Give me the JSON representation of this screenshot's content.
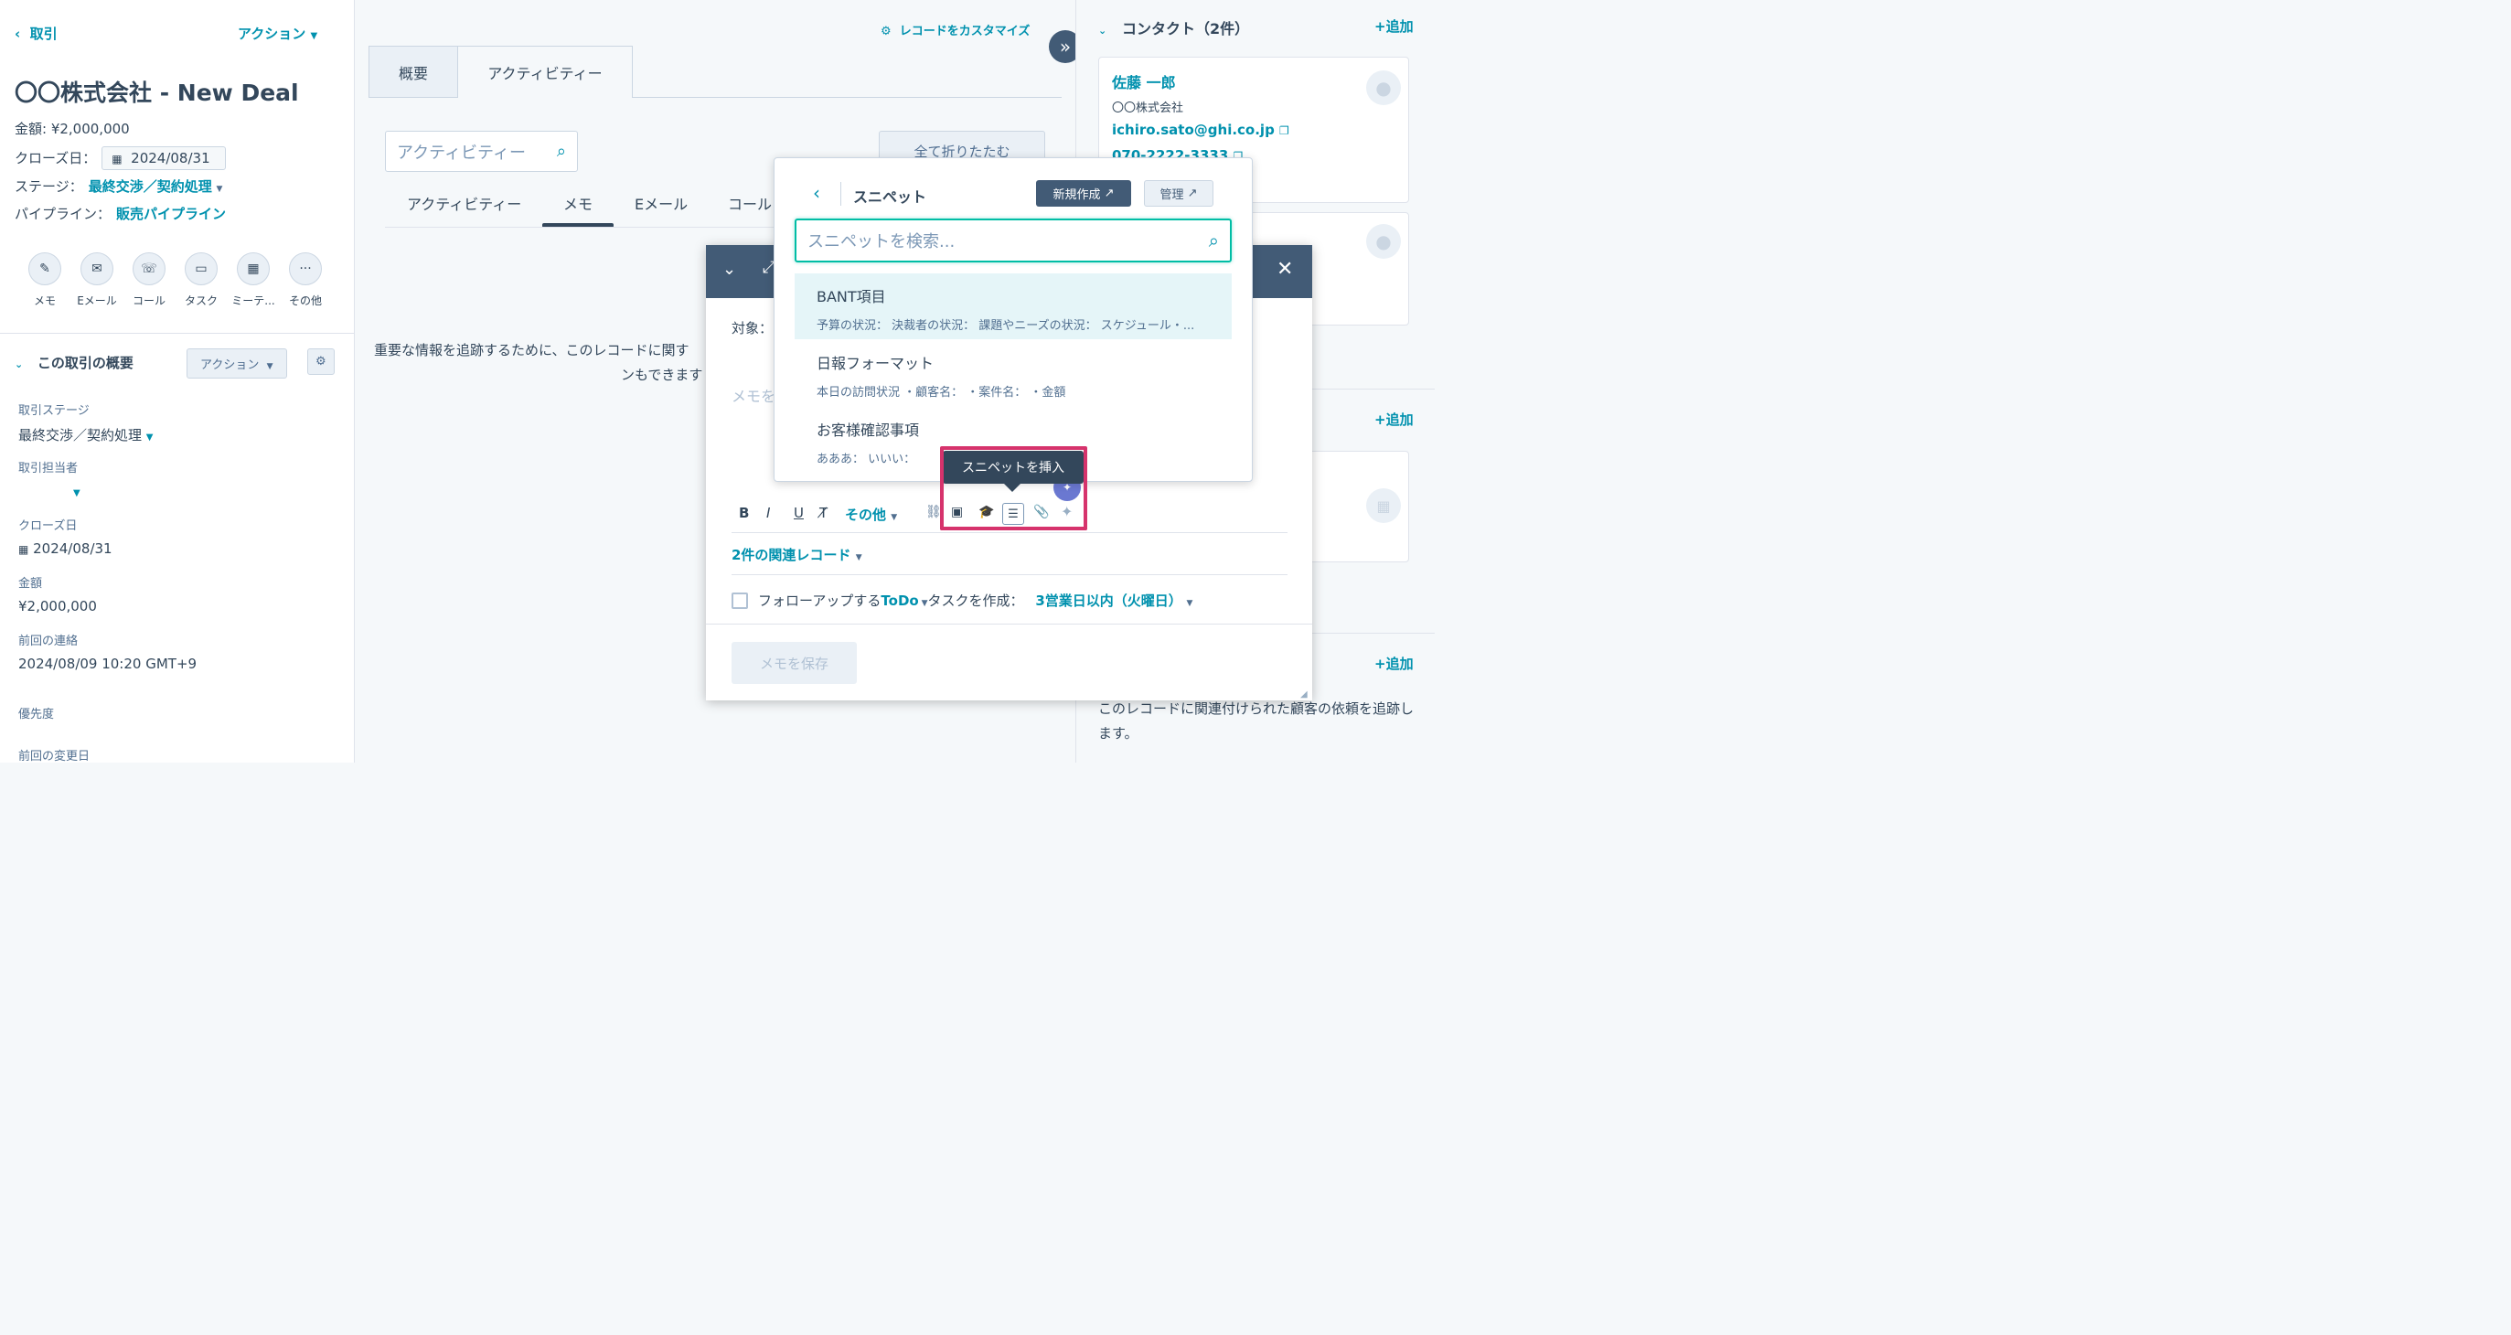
{
  "left": {
    "back_label": "取引",
    "actions_label": "アクション",
    "record_title": "〇〇株式会社 - New Deal",
    "amount_line": "金額: ¥2,000,000",
    "close_date_label": "クローズ日：",
    "close_date_value": "2024/08/31",
    "stage_label": "ステージ：",
    "stage_value": "最終交渉／契約処理",
    "pipeline_label": "パイプライン：",
    "pipeline_value": "販売パイプライン",
    "quick_actions": [
      "メモ",
      "Eメール",
      "コール",
      "タスク",
      "ミーテ...",
      "その他"
    ],
    "summary_title": "この取引の概要",
    "summary_actions": "アクション",
    "props": [
      {
        "label": "取引ステージ",
        "value": "最終交渉／契約処理"
      },
      {
        "label": "取引担当者",
        "value": ""
      },
      {
        "label": "クローズ日",
        "value": "2024/08/31"
      },
      {
        "label": "金額",
        "value": "¥2,000,000"
      },
      {
        "label": "前回の連絡",
        "value": "2024/08/09 10:20 GMT+9"
      },
      {
        "label": "優先度",
        "value": ""
      },
      {
        "label": "前回の変更日",
        "value": ""
      }
    ]
  },
  "middle": {
    "customize": "レコードをカスタマイズ",
    "tabs": [
      "概要",
      "アクティビティー"
    ],
    "search_placeholder": "アクティビティー",
    "collapse_all": "全て折りたたむ",
    "subtabs": [
      "アクティビティー",
      "メモ",
      "Eメール",
      "コール"
    ],
    "empty_text_1": "重要な情報を追跡するために、このレコードに関す",
    "empty_text_2": "ンもできます"
  },
  "right": {
    "contacts_title": "コンタクト（2件）",
    "add": "+追加",
    "contact_name": "佐藤 一郎",
    "contact_company": "〇〇株式会社",
    "contact_email": "ichiro.sato@ghi.co.jp",
    "contact_phone": "070-2222-3333",
    "ticket_text": "このレコードに関連付けられた顧客の依頼を追跡します。"
  },
  "modal": {
    "target_label": "対象：",
    "note_placeholder": "メモを",
    "more_label": "その他",
    "tooltip": "スニペットを挿入",
    "assoc_label": "2件の関連レコード",
    "followup_a": "フォローアップする",
    "followup_todo": "ToDo",
    "followup_b": "タスクを作成：",
    "followup_due": "3営業日以内（火曜日）",
    "save_label": "メモを保存"
  },
  "snippets": {
    "title": "スニペット",
    "new_label": "新規作成",
    "manage_label": "管理",
    "search_placeholder": "スニペットを検索...",
    "items": [
      {
        "title": "BANT項目",
        "desc": "予算の状況： 決裁者の状況： 課題やニーズの状況： スケジュール・..."
      },
      {
        "title": "日報フォーマット",
        "desc": "本日の訪問状況 ・顧客名： ・案件名： ・金額"
      },
      {
        "title": "お客様確認事項",
        "desc": "あああ： いいい："
      }
    ]
  },
  "colors": {
    "accent": "#0091ae",
    "header": "#425b76",
    "highlight": "#d6336c"
  }
}
